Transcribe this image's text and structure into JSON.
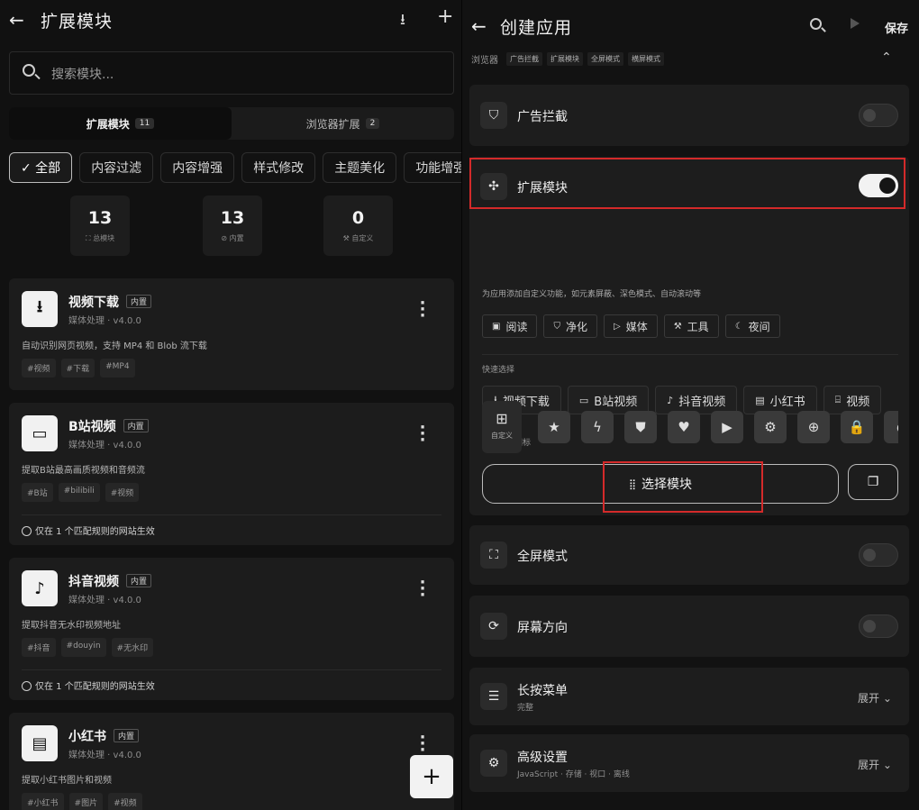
{
  "left": {
    "header": {
      "back_glyph": "←",
      "title": "扩展模块",
      "download_glyph": "⭳",
      "add_glyph": "+"
    },
    "search": {
      "placeholder": "搜索模块..."
    },
    "tabs": [
      {
        "label": "扩展模块",
        "count": "11",
        "active": true
      },
      {
        "label": "浏览器扩展",
        "count": "2",
        "active": false
      }
    ],
    "filters": [
      {
        "label": "✓ 全部",
        "active": true
      },
      {
        "label": "内容过滤",
        "active": false
      },
      {
        "label": "内容增强",
        "active": false
      },
      {
        "label": "样式修改",
        "active": false
      },
      {
        "label": "主题美化",
        "active": false
      },
      {
        "label": "功能增强",
        "active": false
      }
    ],
    "stats": [
      {
        "value": "13",
        "label": "⛶ 总模块"
      },
      {
        "value": "13",
        "label": "⊘ 内置"
      },
      {
        "value": "0",
        "label": "⚒ 自定义"
      }
    ],
    "modules": [
      {
        "icon": "download-icon",
        "glyph": "⭳",
        "title": "视频下载",
        "tag": "内置",
        "sub": "媒体处理 · v4.0.0",
        "desc": "自动识别网页视频，支持 MP4 和 Blob 流下载",
        "tags": [
          "#视频",
          "#下载",
          "#MP4"
        ],
        "footer": ""
      },
      {
        "icon": "monitor-icon",
        "glyph": "▭",
        "title": "B站视频",
        "tag": "内置",
        "sub": "媒体处理 · v4.0.0",
        "desc": "提取B站最高画质视频和音频流",
        "tags": [
          "#B站",
          "#bilibili",
          "#视频"
        ],
        "footer": "仅在 1 个匹配规则的网站生效"
      },
      {
        "icon": "music-note-icon",
        "glyph": "♪",
        "title": "抖音视频",
        "tag": "内置",
        "sub": "媒体处理 · v4.0.0",
        "desc": "提取抖音无水印视频地址",
        "tags": [
          "#抖音",
          "#douyin",
          "#无水印"
        ],
        "footer": "仅在 1 个匹配规则的网站生效"
      },
      {
        "icon": "book-icon",
        "glyph": "▤",
        "title": "小红书",
        "tag": "内置",
        "sub": "媒体处理 · v4.0.0",
        "desc": "提取小红书图片和视频",
        "tags": [
          "#小红书",
          "#图片",
          "#视频"
        ],
        "footer": ""
      }
    ],
    "fab_glyph": "+"
  },
  "right": {
    "header": {
      "back_glyph": "←",
      "title": "创建应用",
      "save_label": "保存"
    },
    "crumbs": {
      "head": "浏览器",
      "items": [
        "广告拦截",
        "扩展模块",
        "全屏模式",
        "横屏模式"
      ],
      "collapse_glyph": "⌃"
    },
    "ad_block": {
      "label": "广告拦截",
      "enabled": false
    },
    "extension": {
      "label": "扩展模块",
      "enabled": true,
      "description": "为应用添加自定义功能，如元素屏蔽、深色模式、自动滚动等",
      "categories": [
        {
          "icon": "book-icon",
          "glyph": "▣",
          "label": "阅读"
        },
        {
          "icon": "shield-icon",
          "glyph": "⛉",
          "label": "净化"
        },
        {
          "icon": "play-icon",
          "glyph": "▷",
          "label": "媒体"
        },
        {
          "icon": "wrench-icon",
          "glyph": "⚒",
          "label": "工具"
        },
        {
          "icon": "moon-icon",
          "glyph": "☾",
          "label": "夜间"
        }
      ],
      "quick_select_label": "快速选择",
      "quick_select": [
        {
          "icon": "download-icon",
          "glyph": "⭳",
          "label": "视频下载"
        },
        {
          "icon": "monitor-icon",
          "glyph": "▭",
          "label": "B站视频"
        },
        {
          "icon": "music-note-icon",
          "glyph": "♪",
          "label": "抖音视频"
        },
        {
          "icon": "book-icon",
          "glyph": "▤",
          "label": "小红书"
        },
        {
          "icon": "film-icon",
          "glyph": "⌸",
          "label": "视频"
        }
      ],
      "float_icon_label": "悬浮按钮图标",
      "custom_icon": {
        "glyph": "⊞",
        "label": "自定义"
      },
      "float_icons": [
        {
          "icon": "star-icon",
          "glyph": "★"
        },
        {
          "icon": "bolt-icon",
          "glyph": "ϟ"
        },
        {
          "icon": "shield-icon",
          "glyph": "⛊"
        },
        {
          "icon": "heart-icon",
          "glyph": "♥"
        },
        {
          "icon": "play-icon",
          "glyph": "▶"
        },
        {
          "icon": "gear-icon",
          "glyph": "⚙"
        },
        {
          "icon": "globe-icon",
          "glyph": "⊕"
        },
        {
          "icon": "lock-icon",
          "glyph": "🔒"
        },
        {
          "icon": "more-icon",
          "glyph": "◖"
        }
      ],
      "select_module_label": "选择模块",
      "copy_glyph": "❐"
    },
    "fullscreen": {
      "label": "全屏模式",
      "enabled": false
    },
    "orientation": {
      "label": "屏幕方向",
      "enabled": false
    },
    "long_press": {
      "label": "长按菜单",
      "sub": "完整",
      "expand": "展开 ⌄"
    },
    "advanced": {
      "label": "高级设置",
      "sub": "JavaScript · 存储 · 视口 · 离线",
      "expand": "展开 ⌄"
    },
    "highlight_color": "#d42a2a"
  }
}
